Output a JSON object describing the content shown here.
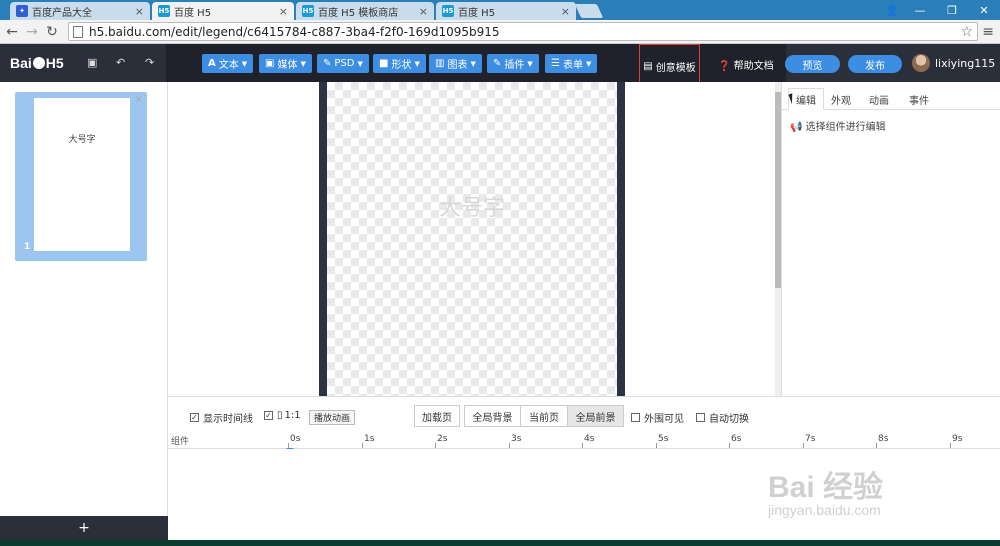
{
  "browser": {
    "tabs": [
      {
        "title": "百度产品大全",
        "favicon": "baidu-icon",
        "active": false
      },
      {
        "title": "百度 H5",
        "favicon": "H5",
        "active": true
      },
      {
        "title": "百度 H5 模板商店",
        "favicon": "H5",
        "active": false
      },
      {
        "title": "百度 H5",
        "favicon": "H5",
        "active": false
      }
    ],
    "url": "h5.baidu.com/edit/legend/c6415784-c887-3ba4-f2f0-169d1095b915"
  },
  "app": {
    "logo": {
      "left": "Bai",
      "right": "H5"
    },
    "tools": [
      {
        "icon": "A",
        "label": "文本"
      },
      {
        "icon": "▣",
        "label": "媒体"
      },
      {
        "icon": "✎",
        "label": "PSD"
      },
      {
        "icon": "■",
        "label": "形状"
      },
      {
        "icon": "▥",
        "label": "图表"
      },
      {
        "icon": "✎",
        "label": "插件"
      },
      {
        "icon": "☰",
        "label": "表单"
      }
    ],
    "creative_template": "创意模板",
    "help": "帮助文档",
    "preview": "预览",
    "publish": "发布",
    "username": "lixiying115"
  },
  "pages": {
    "thumb_text": "大号字",
    "page_number": "1",
    "add": "+"
  },
  "canvas": {
    "text": "大号字"
  },
  "right_panel": {
    "tabs": [
      "编辑",
      "外观",
      "动画",
      "事件"
    ],
    "hint": "选择组件进行编辑"
  },
  "timeline": {
    "show_timeline": "显示时间线",
    "ratio": "1:1",
    "play_animation": "播放动画",
    "load_page": "加载页",
    "scope_tabs": [
      "全局背景",
      "当前页",
      "全局前景"
    ],
    "outside_visible": "外围可见",
    "auto_switch": "自动切换",
    "component_label": "组件",
    "ticks": [
      "0s",
      "1s",
      "2s",
      "3s",
      "4s",
      "5s",
      "6s",
      "7s",
      "8s",
      "9s"
    ]
  },
  "watermark": {
    "logo": "Bai 经验",
    "url": "jingyan.baidu.com"
  }
}
